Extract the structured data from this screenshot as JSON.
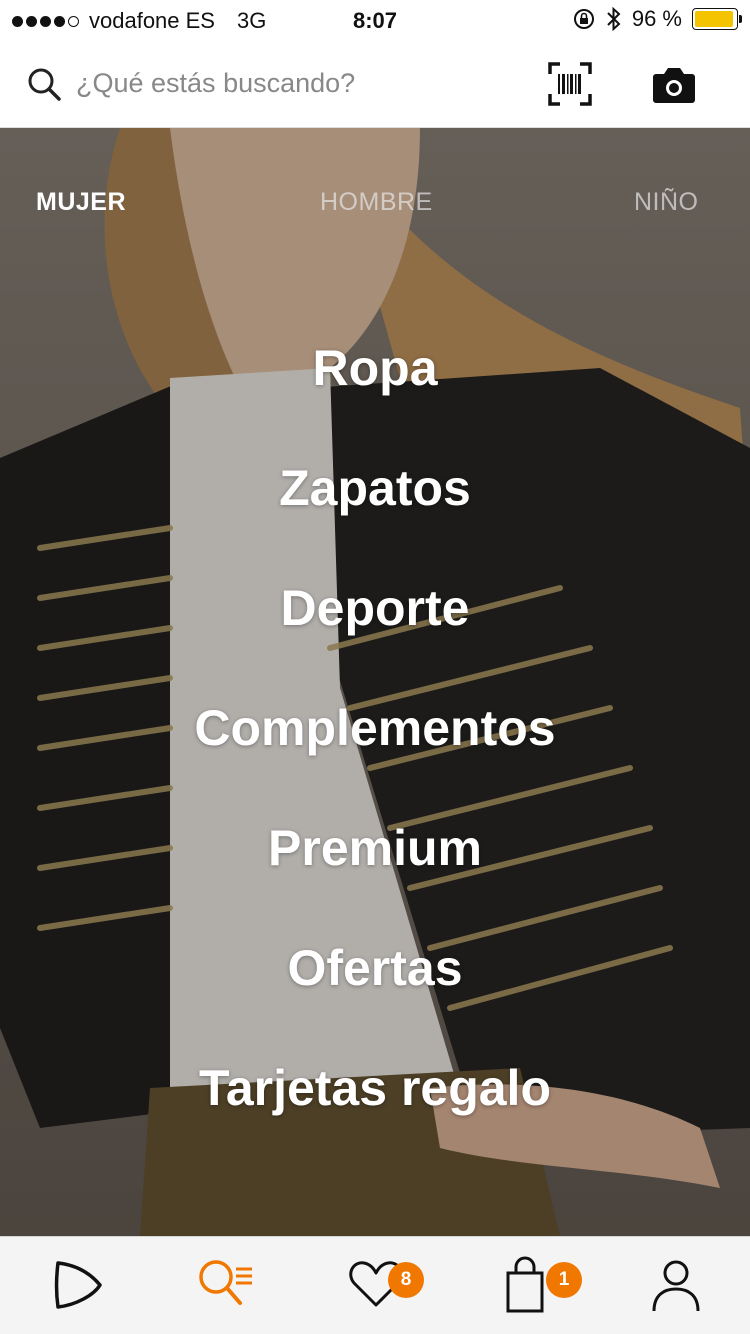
{
  "status_bar": {
    "carrier": "vodafone ES",
    "network": "3G",
    "time": "8:07",
    "battery": "96 %",
    "battery_level": 0.96,
    "icons": [
      "signal-dots-icon",
      "lock-rotation-icon",
      "bluetooth-icon",
      "battery-icon"
    ]
  },
  "search": {
    "placeholder": "¿Qué estás buscando?",
    "icons": [
      "search-icon",
      "barcode-scan-icon",
      "camera-icon"
    ]
  },
  "tabs": [
    {
      "label": "MUJER",
      "active": true
    },
    {
      "label": "HOMBRE",
      "active": false
    },
    {
      "label": "NIÑO",
      "active": false
    }
  ],
  "menu": [
    {
      "label": "Ropa"
    },
    {
      "label": "Zapatos"
    },
    {
      "label": "Deporte"
    },
    {
      "label": "Complementos"
    },
    {
      "label": "Premium"
    },
    {
      "label": "Ofertas"
    },
    {
      "label": "Tarjetas regalo"
    }
  ],
  "tabbar": {
    "items": [
      "home-logo-icon",
      "search-list-icon",
      "heart-icon",
      "shopping-bag-icon",
      "profile-icon"
    ],
    "favorites_count": "8",
    "bag_count": "1"
  },
  "colors": {
    "accent": "#f07800",
    "battery": "#f5c400"
  }
}
